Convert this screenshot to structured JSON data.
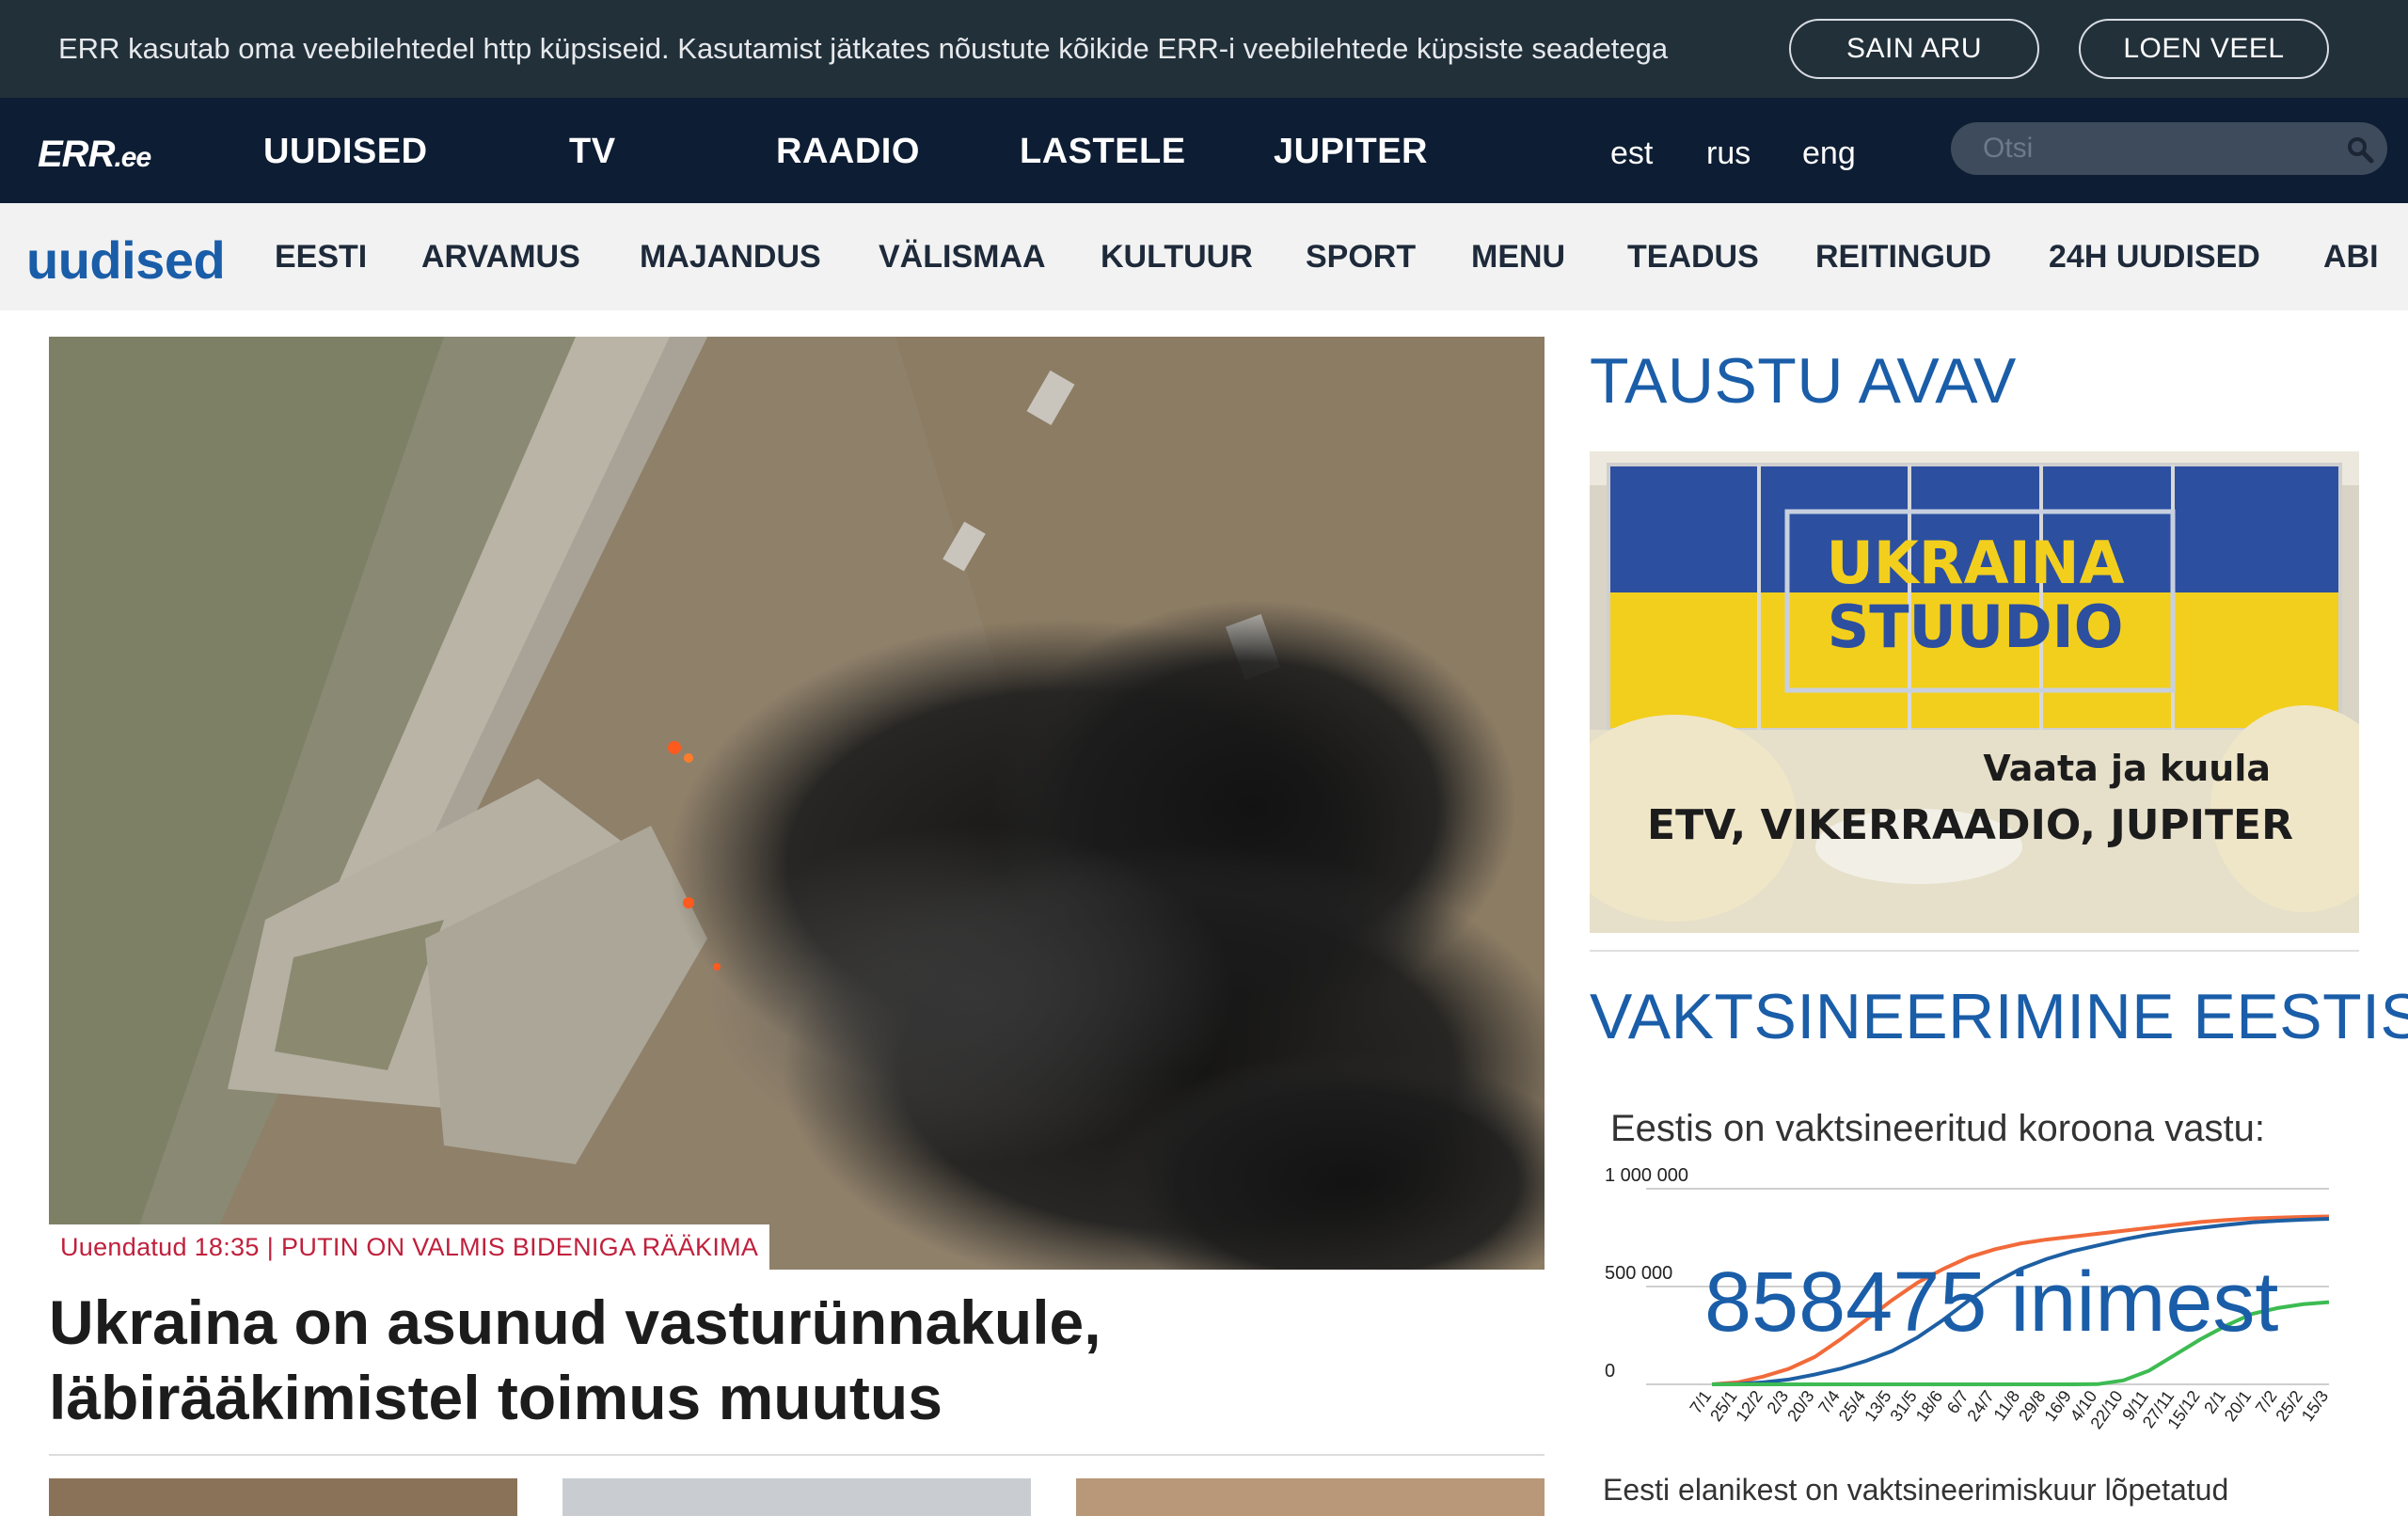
{
  "cookie": {
    "message": "ERR kasutab oma veebilehtedel http küpsiseid. Kasutamist jätkates nõustute kõikide ERR-i veebilehtede küpsiste seadetega",
    "agree_label": "SAIN ARU",
    "more_label": "LOEN VEEL"
  },
  "topnav": {
    "logo_main": "ERR",
    "logo_suffix": ".ee",
    "items": [
      "UUDISED",
      "TV",
      "RAADIO",
      "LASTELE",
      "JUPITER"
    ],
    "languages": [
      "est",
      "rus",
      "eng"
    ],
    "search_placeholder": "Otsi"
  },
  "secnav": {
    "brand": "uudised",
    "items": [
      "EESTI",
      "ARVAMUS",
      "MAJANDUS",
      "VÄLISMAA",
      "KULTUUR",
      "SPORT",
      "MENU",
      "TEADUS",
      "REITINGUD",
      "24H UUDISED",
      "ABI"
    ]
  },
  "hero": {
    "tag_time": "Uuendatud 18:35",
    "tag_separator": "|",
    "tag_topic": "PUTIN ON VALMIS BIDENIGA RÄÄKIMA",
    "headline": "Ukraina on asunud vasturünnakule, läbirääkimistel toimus muutus"
  },
  "right": {
    "section1_title": "TAUSTU AVAV",
    "promo": {
      "title_line1": "UKRAINA",
      "title_line2": "STUUDIO",
      "tagline": "Vaata ja kuula",
      "channels": "ETV, VIKERRAADIO, JUPITER"
    },
    "section2_title": "VAKTSINEERIMINE EESTIS",
    "vax_subtitle": "Eestis on vaktsineeritud koroona vastu:",
    "vax_count": "858475 inimest",
    "vax_note": "Eesti elanikest on vaktsineerimiskuur lõpetatud"
  },
  "chart_data": {
    "type": "line",
    "title": "",
    "xlabel": "",
    "ylabel": "",
    "ylim": [
      0,
      1000000
    ],
    "y_ticks": [
      "1 000 000",
      "500 000",
      "0"
    ],
    "y_tick_values": [
      1000000,
      500000,
      0
    ],
    "categories": [
      "7/1",
      "25/1",
      "12/2",
      "2/3",
      "20/3",
      "7/4",
      "25/4",
      "13/5",
      "31/5",
      "18/6",
      "6/7",
      "24/7",
      "11/8",
      "29/8",
      "16/9",
      "4/10",
      "22/10",
      "9/11",
      "27/11",
      "15/12",
      "2/1",
      "20/1",
      "7/2",
      "25/2",
      "15/3"
    ],
    "series": [
      {
        "name": "",
        "color": "#f26a3a",
        "values": [
          0,
          10000,
          40000,
          80000,
          140000,
          230000,
          330000,
          430000,
          520000,
          590000,
          650000,
          690000,
          720000,
          740000,
          755000,
          770000,
          785000,
          800000,
          815000,
          830000,
          840000,
          848000,
          852000,
          856000,
          858475
        ]
      },
      {
        "name": "",
        "color": "#1d5fa3",
        "values": [
          0,
          2000,
          10000,
          25000,
          50000,
          80000,
          120000,
          170000,
          240000,
          330000,
          430000,
          520000,
          590000,
          640000,
          680000,
          710000,
          740000,
          765000,
          785000,
          800000,
          815000,
          828000,
          836000,
          842000,
          846000
        ]
      },
      {
        "name": "",
        "color": "#3dbb52",
        "values": [
          0,
          0,
          0,
          0,
          0,
          0,
          0,
          0,
          0,
          0,
          0,
          0,
          0,
          0,
          0,
          1000,
          20000,
          70000,
          150000,
          230000,
          300000,
          360000,
          390000,
          410000,
          420000
        ]
      }
    ]
  }
}
